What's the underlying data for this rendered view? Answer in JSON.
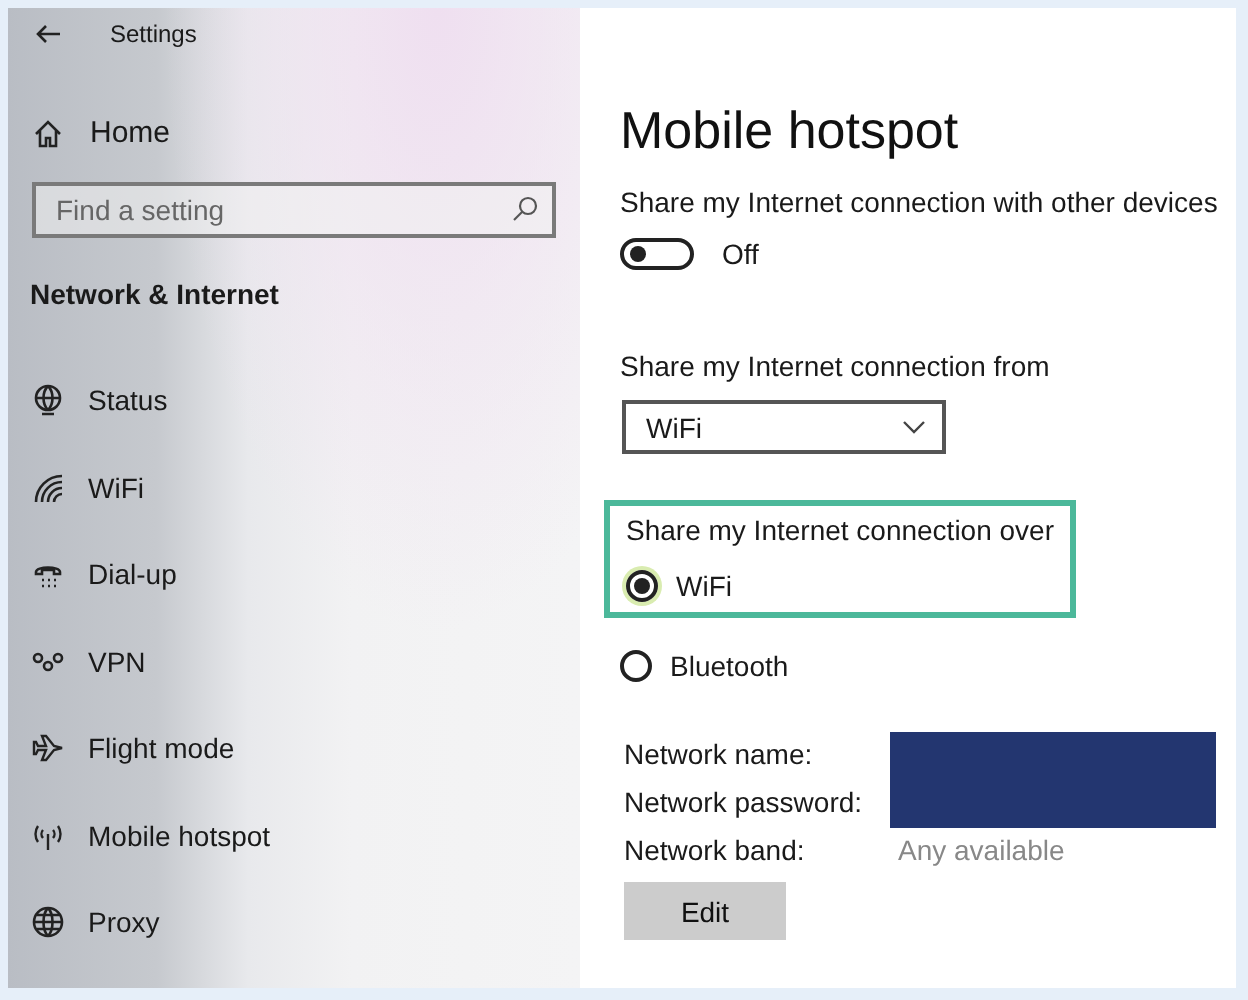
{
  "window": {
    "title": "Settings"
  },
  "sidebar": {
    "home": "Home",
    "search": {
      "placeholder": "Find a setting"
    },
    "section": "Network & Internet",
    "items": [
      {
        "label": "Status"
      },
      {
        "label": "WiFi"
      },
      {
        "label": "Dial-up"
      },
      {
        "label": "VPN"
      },
      {
        "label": "Flight mode"
      },
      {
        "label": "Mobile hotspot"
      },
      {
        "label": "Proxy"
      }
    ]
  },
  "main": {
    "title": "Mobile hotspot",
    "share_toggle": {
      "label": "Share my Internet connection with other devices",
      "on": false,
      "state_text": "Off"
    },
    "share_from": {
      "label": "Share my Internet connection from",
      "value": "WiFi"
    },
    "share_over": {
      "label": "Share my Internet connection over",
      "highlighted": true,
      "options": [
        {
          "label": "WiFi",
          "selected": true
        },
        {
          "label": "Bluetooth",
          "selected": false
        }
      ]
    },
    "network": [
      {
        "label": "Network name:",
        "kind": "hidden"
      },
      {
        "label": "Network password:",
        "kind": "hidden"
      },
      {
        "label": "Network band:",
        "kind": "text",
        "value": "Any available"
      }
    ],
    "edit_button": "Edit"
  }
}
